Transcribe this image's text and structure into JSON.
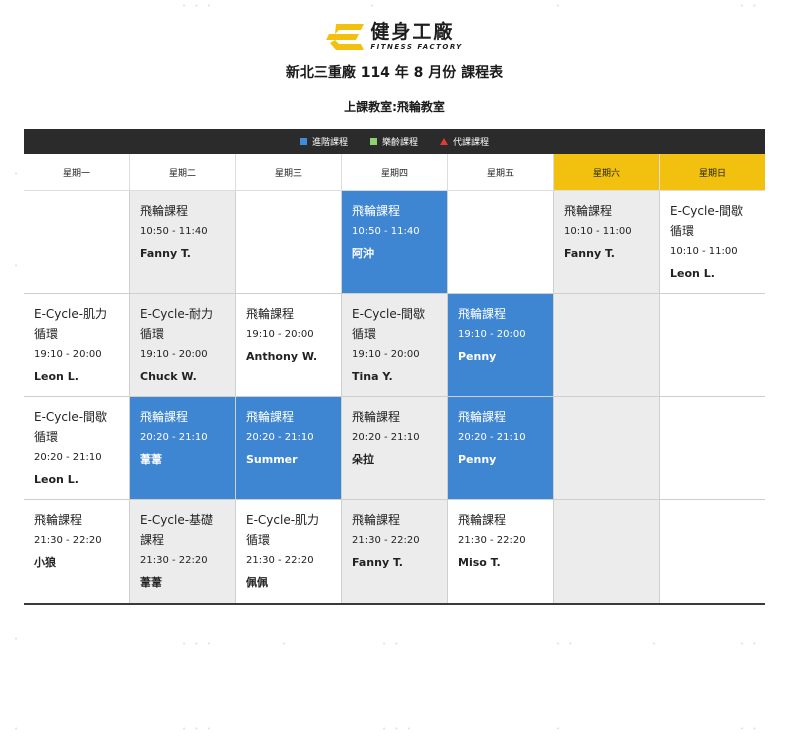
{
  "logo": {
    "cn": "健身工廠",
    "en": "FITNESS FACTORY",
    "brand_color": "#f2c10f"
  },
  "title": "新北三重廠 114 年 8 月份 課程表",
  "subtitle": "上課教室:飛輪教室",
  "legend": [
    {
      "label": "進階課程",
      "icon": "blue-square",
      "color": "#3f8bdc"
    },
    {
      "label": "樂齡課程",
      "icon": "green-square",
      "color": "#8ed16f"
    },
    {
      "label": "代課課程",
      "icon": "red-triangle",
      "color": "#e53935"
    }
  ],
  "days": [
    "星期一",
    "星期二",
    "星期三",
    "星期四",
    "星期五",
    "星期六",
    "星期日"
  ],
  "rows": [
    [
      {
        "style": "plain"
      },
      {
        "style": "grey",
        "name": "飛輪課程",
        "time": "10:50 - 11:40",
        "coach": "Fanny T."
      },
      {
        "style": "plain"
      },
      {
        "style": "blue",
        "name": "飛輪課程",
        "time": "10:50 - 11:40",
        "coach": "阿沖"
      },
      {
        "style": "plain"
      },
      {
        "style": "grey",
        "name": "飛輪課程",
        "time": "10:10 - 11:00",
        "coach": "Fanny T."
      },
      {
        "style": "plain",
        "name": "E-Cycle-間歇循環",
        "time": "10:10 - 11:00",
        "coach": "Leon L."
      }
    ],
    [
      {
        "style": "plain",
        "name": "E-Cycle-肌力循環",
        "time": "19:10 - 20:00",
        "coach": "Leon L."
      },
      {
        "style": "grey",
        "name": "E-Cycle-耐力循環",
        "time": "19:10 - 20:00",
        "coach": "Chuck W."
      },
      {
        "style": "plain",
        "name": "飛輪課程",
        "time": "19:10 - 20:00",
        "coach": "Anthony W."
      },
      {
        "style": "grey",
        "name": "E-Cycle-間歇循環",
        "time": "19:10 - 20:00",
        "coach": "Tina Y."
      },
      {
        "style": "blue",
        "name": "飛輪課程",
        "time": "19:10 - 20:00",
        "coach": "Penny"
      },
      {
        "style": "grey"
      },
      {
        "style": "plain"
      }
    ],
    [
      {
        "style": "plain",
        "name": "E-Cycle-間歇循環",
        "time": "20:20 - 21:10",
        "coach": "Leon L."
      },
      {
        "style": "blue",
        "name": "飛輪課程",
        "time": "20:20 - 21:10",
        "coach": "葦葦"
      },
      {
        "style": "blue",
        "name": "飛輪課程",
        "time": "20:20 - 21:10",
        "coach": "Summer"
      },
      {
        "style": "grey",
        "name": "飛輪課程",
        "time": "20:20 - 21:10",
        "coach": "朵拉"
      },
      {
        "style": "blue",
        "name": "飛輪課程",
        "time": "20:20 - 21:10",
        "coach": "Penny"
      },
      {
        "style": "grey"
      },
      {
        "style": "plain"
      }
    ],
    [
      {
        "style": "plain",
        "name": "飛輪課程",
        "time": "21:30 - 22:20",
        "coach": "小狼"
      },
      {
        "style": "grey",
        "name": "E-Cycle-基礎課程",
        "time": "21:30 - 22:20",
        "coach": "葦葦"
      },
      {
        "style": "plain",
        "name": "E-Cycle-肌力循環",
        "time": "21:30 - 22:20",
        "coach": "佩佩"
      },
      {
        "style": "grey",
        "name": "飛輪課程",
        "time": "21:30 - 22:20",
        "coach": "Fanny T."
      },
      {
        "style": "plain",
        "name": "飛輪課程",
        "time": "21:30 - 22:20",
        "coach": "Miso T."
      },
      {
        "style": "grey"
      },
      {
        "style": "plain"
      }
    ]
  ]
}
